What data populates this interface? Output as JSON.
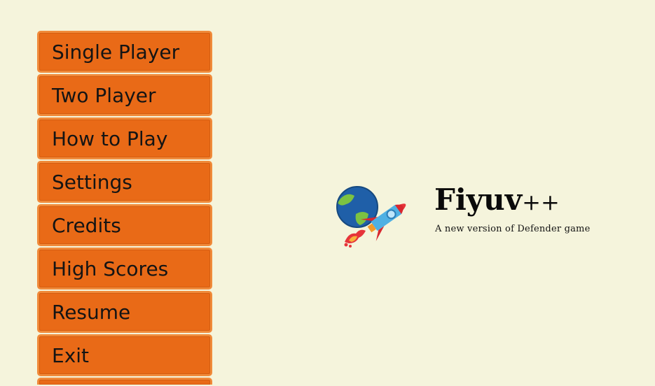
{
  "menu": {
    "items": [
      {
        "label": "Single Player"
      },
      {
        "label": "Two Player"
      },
      {
        "label": "How to Play"
      },
      {
        "label": "Settings"
      },
      {
        "label": "Credits"
      },
      {
        "label": "High Scores"
      },
      {
        "label": "Resume"
      },
      {
        "label": "Exit"
      }
    ]
  },
  "logo": {
    "title_main": "Fiyuv",
    "title_suffix": "++",
    "subtitle": "A new version of Defender game",
    "icon": "rocket-and-planet-icon"
  },
  "colors": {
    "background": "#f5f4dc",
    "button": "#e96a17",
    "button_border": "#f08a3a",
    "text": "#141414"
  }
}
